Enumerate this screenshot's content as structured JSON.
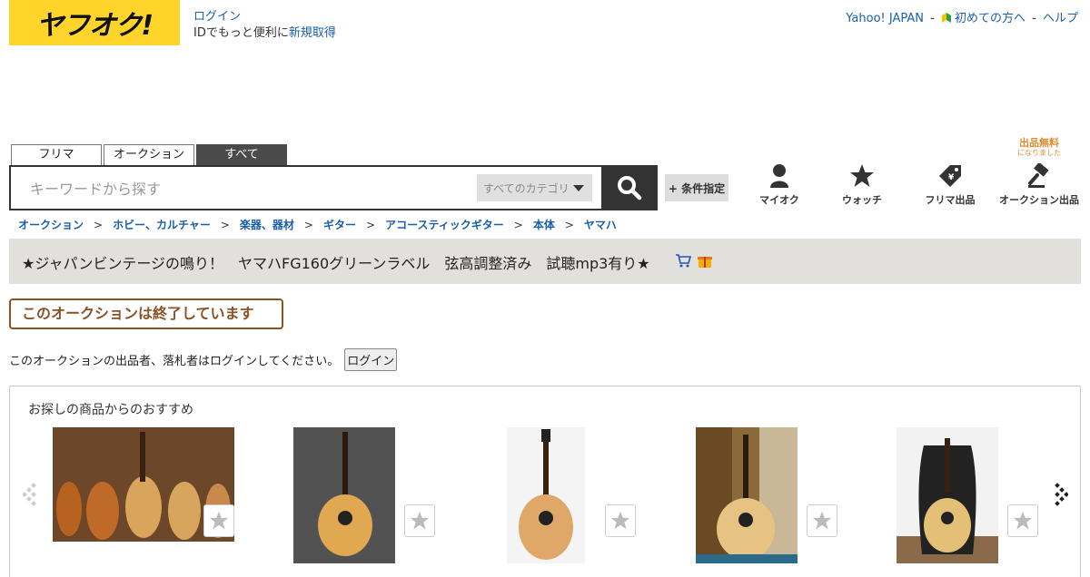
{
  "header": {
    "logo_text": "ヤフオク!",
    "login_link": "ログイン",
    "login_prompt": "IDでもっと便利に",
    "signup_link": "新規取得",
    "yahoo_japan": "Yahoo! JAPAN",
    "sep": "-",
    "beginners": "初めての方へ",
    "help": "ヘルプ"
  },
  "search": {
    "tabs": [
      "フリマ",
      "オークション",
      "すべて"
    ],
    "active_tab": "すべて",
    "placeholder": "キーワードから探す",
    "category": "すべてのカテゴリ",
    "condition_button": "+ 条件指定",
    "search_icon": "search-icon"
  },
  "nav_icons": [
    {
      "label": "マイオク",
      "icon": "person-icon"
    },
    {
      "label": "ウォッチ",
      "icon": "star-icon"
    },
    {
      "label": "フリマ出品",
      "icon": "price-tag-icon"
    },
    {
      "label": "オークション出品",
      "icon": "gavel-icon"
    }
  ],
  "free_badge": {
    "main": "出品無料",
    "sub": "になりました"
  },
  "breadcrumb": {
    "items": [
      "オークション",
      "ホビー、カルチャー",
      "楽器、器材",
      "ギター",
      "アコースティックギター",
      "本体",
      "ヤマハ"
    ],
    "separator": ">"
  },
  "item": {
    "title": "★ジャパンビンテージの鳴り！　ヤマハFG160グリーンラベル　弦高調整済み　試聴mp3有り★",
    "ended_message": "このオークションは終了しています",
    "login_notice": "このオークションの出品者、落札者はログインしてください。",
    "login_button": "ログイン"
  },
  "recommendations": {
    "title": "お探しの商品からのおすすめ",
    "cards": [
      {
        "image": "guitars-row-photo"
      },
      {
        "image": "acoustic-guitar-photo"
      },
      {
        "image": "acoustic-guitar-photo"
      },
      {
        "image": "acoustic-guitar-photo"
      },
      {
        "image": "acoustic-guitar-case-photo"
      }
    ]
  },
  "colors": {
    "brand_yellow": "#ffd52c",
    "link_blue": "#1a5fa8",
    "ended_brown": "#8a5326",
    "title_bar": "#e1e0dc"
  }
}
